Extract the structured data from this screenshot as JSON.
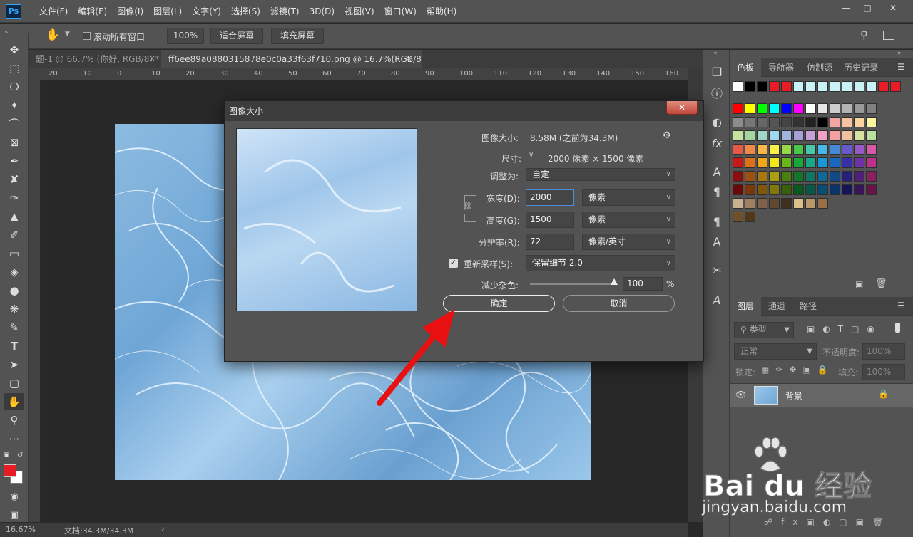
{
  "app": {
    "logo": "Ps"
  },
  "menu": [
    "文件(F)",
    "编辑(E)",
    "图像(I)",
    "图层(L)",
    "文字(Y)",
    "选择(S)",
    "滤镜(T)",
    "3D(D)",
    "视图(V)",
    "窗口(W)",
    "帮助(H)"
  ],
  "options": {
    "scroll_all": "滚动所有窗口",
    "zoom": "100%",
    "fit": "适合屏幕",
    "fill": "填充屏幕"
  },
  "tabs": [
    "题-1 @ 66.7% (你好, RGB/8) *",
    "ff6ee89a0880315878e0c0a33f63f710.png @ 16.7%(RGB/8)"
  ],
  "ruler": [
    "20",
    "10",
    "0",
    "10",
    "20",
    "30",
    "40",
    "50",
    "60",
    "70",
    "80",
    "90",
    "100",
    "110",
    "120",
    "130",
    "140",
    "150",
    "160"
  ],
  "status": {
    "zoom": "16.67%",
    "doc": "文档:34.3M/34.3M"
  },
  "swatch_tabs": [
    "色板",
    "导航器",
    "仿制源",
    "历史记录"
  ],
  "layer_tabs": [
    "图层",
    "通道",
    "路径"
  ],
  "layers": {
    "filter": "类型",
    "mode": "正常",
    "opacity_label": "不透明度:",
    "opacity": "100%",
    "lock_label": "锁定:",
    "fill_label": "填充:",
    "fill": "100%",
    "layer_name": "背景"
  },
  "dialog": {
    "title": "图像大小",
    "image_size_label": "图像大小:",
    "image_size_value": "8.58M (之前为34.3M)",
    "dimensions_label": "尺寸:",
    "dimensions_value": "2000 像素 × 1500 像素",
    "fit_label": "调整为:",
    "fit_value": "自定",
    "width_label": "宽度(D):",
    "width_value": "2000",
    "width_unit": "像素",
    "height_label": "高度(G):",
    "height_value": "1500",
    "height_unit": "像素",
    "res_label": "分辨率(R):",
    "res_value": "72",
    "res_unit": "像素/英寸",
    "resample_label": "重新采样(S):",
    "resample_value": "保留细节 2.0",
    "noise_label": "减少杂色:",
    "noise_value": "100",
    "noise_pct": "%",
    "ok": "确定",
    "cancel": "取消"
  },
  "watermark": {
    "brand": "Bai du 经验",
    "url": "jingyan.baidu.com"
  },
  "colors": {
    "accent": "#31a8ff",
    "arrow": "#e81010",
    "fg_swatch": "#e81c24",
    "panel": "#535353"
  }
}
